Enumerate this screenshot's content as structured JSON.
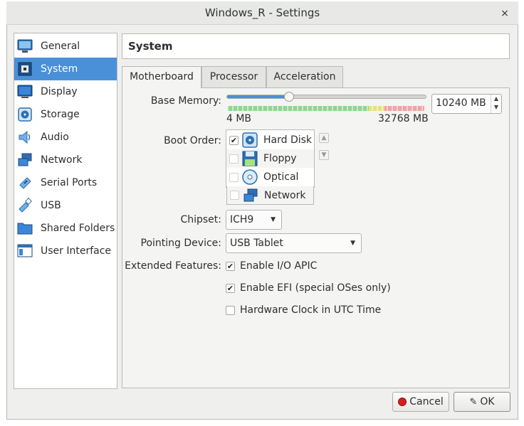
{
  "window": {
    "title": "Windows_R - Settings",
    "close_glyph": "×"
  },
  "sidebar": {
    "items": [
      {
        "label": "General",
        "icon": "monitor-icon"
      },
      {
        "label": "System",
        "icon": "motherboard-chip-icon",
        "active": true
      },
      {
        "label": "Display",
        "icon": "display-icon"
      },
      {
        "label": "Storage",
        "icon": "disk-icon"
      },
      {
        "label": "Audio",
        "icon": "speaker-icon"
      },
      {
        "label": "Network",
        "icon": "network-icon"
      },
      {
        "label": "Serial Ports",
        "icon": "serial-port-icon"
      },
      {
        "label": "USB",
        "icon": "usb-icon"
      },
      {
        "label": "Shared Folders",
        "icon": "folder-icon"
      },
      {
        "label": "User Interface",
        "icon": "window-layout-icon"
      }
    ]
  },
  "section_title": "System",
  "tabs": [
    {
      "label": "Motherboard",
      "active": true
    },
    {
      "label": "Processor"
    },
    {
      "label": "Acceleration"
    }
  ],
  "motherboard": {
    "base_memory": {
      "label": "Base Memory:",
      "value": "10240 MB",
      "slider_fraction": 0.3125,
      "min_label": "4 MB",
      "max_label": "32768 MB"
    },
    "boot_order": {
      "label": "Boot Order:",
      "items": [
        {
          "label": "Hard Disk",
          "checked": true,
          "icon": "hard-disk-icon"
        },
        {
          "label": "Floppy",
          "checked": false,
          "icon": "floppy-icon"
        },
        {
          "label": "Optical",
          "checked": false,
          "icon": "optical-disc-icon"
        },
        {
          "label": "Network",
          "checked": false,
          "icon": "network-icon"
        }
      ],
      "up_glyph": "▲",
      "down_glyph": "▼"
    },
    "chipset": {
      "label": "Chipset:",
      "value": "ICH9"
    },
    "pointing_device": {
      "label": "Pointing Device:",
      "value": "USB Tablet"
    },
    "extended_features": {
      "label": "Extended Features:",
      "items": [
        {
          "label": "Enable I/O APIC",
          "checked": true
        },
        {
          "label": "Enable EFI (special OSes only)",
          "checked": true
        },
        {
          "label": "Hardware Clock in UTC Time",
          "checked": false
        }
      ]
    }
  },
  "buttons": {
    "cancel": "Cancel",
    "ok": "OK"
  },
  "colors": {
    "accent": "#4a90d9",
    "scale_green": "#8fd68f",
    "scale_yellow": "#e8e08a",
    "scale_red": "#f0a3a3"
  }
}
